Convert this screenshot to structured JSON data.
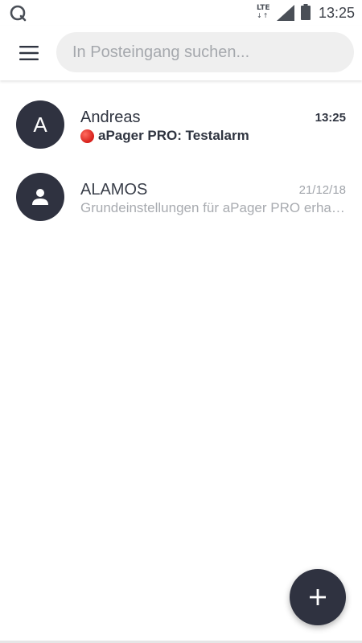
{
  "status_bar": {
    "app_icon": "circle-q-icon",
    "network_label": "LTE",
    "network_arrows": "↓↑",
    "signal_icon": "signal-icon",
    "battery_icon": "battery-icon",
    "time": "13:25"
  },
  "app_bar": {
    "menu_icon": "menu-icon",
    "search_placeholder": "In Posteingang suchen..."
  },
  "conversations": [
    {
      "avatar_text": "A",
      "name": "Andreas",
      "time": "13:25",
      "preview": "aPager PRO: Testalarm",
      "preview_icon": "red-circle-icon",
      "unread": true
    },
    {
      "avatar_icon": "person-icon",
      "name": "ALAMOS",
      "time": "21/12/18",
      "preview": "Grundeinstellungen für aPager PRO erhalten",
      "unread": false
    }
  ],
  "fab": {
    "icon": "plus-icon"
  },
  "colors": {
    "avatar_bg": "#2f3240",
    "search_bg": "#efefef",
    "alarm_red": "#d61f1a",
    "muted_text": "#a8abb0"
  }
}
